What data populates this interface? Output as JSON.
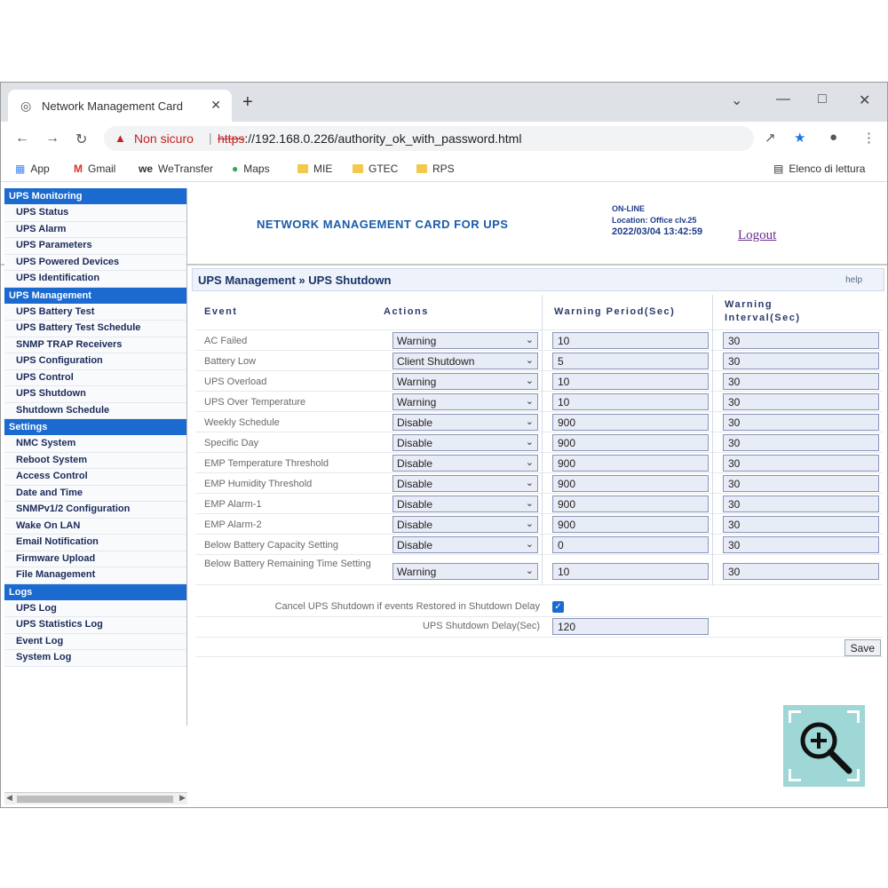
{
  "browser": {
    "tab_title": "Network Management Card",
    "address_warning": "Non sicuro",
    "url_scheme": "https",
    "url_rest": "://192.168.0.226/authority_ok_with_password.html",
    "bookmarks": [
      {
        "label": "App",
        "icon": "grid-icon"
      },
      {
        "label": "Gmail",
        "icon": "gmail-icon"
      },
      {
        "label": "WeTransfer",
        "icon": "wetransfer-icon"
      },
      {
        "label": "Maps",
        "icon": "maps-icon"
      },
      {
        "label": "MIE",
        "icon": "folder-icon"
      },
      {
        "label": "GTEC",
        "icon": "folder-icon"
      },
      {
        "label": "RPS",
        "icon": "folder-icon"
      }
    ],
    "reading_list": "Elenco di lettura"
  },
  "header": {
    "title": "NETWORK MANAGEMENT CARD FOR UPS",
    "status": "ON-LINE",
    "location": "Location: Office clv.25",
    "datetime": "2022/03/04 13:42:59",
    "logout": "Logout"
  },
  "sidebar": [
    {
      "heading": "UPS Monitoring",
      "items": [
        "UPS Status",
        "UPS Alarm",
        "UPS Parameters",
        "UPS Powered Devices",
        "UPS Identification"
      ]
    },
    {
      "heading": "UPS Management",
      "items": [
        "UPS Battery Test",
        "UPS Battery Test Schedule",
        "SNMP TRAP Receivers",
        "UPS Configuration",
        "UPS Control",
        "UPS Shutdown",
        "Shutdown Schedule"
      ]
    },
    {
      "heading": "Settings",
      "items": [
        "NMC System",
        "Reboot System",
        "Access Control",
        "Date and Time",
        "SNMPv1/2 Configuration",
        "Wake On LAN",
        "Email Notification",
        "Firmware Upload",
        "File Management"
      ]
    },
    {
      "heading": "Logs",
      "items": [
        "UPS Log",
        "UPS Statistics Log",
        "Event Log",
        "System Log"
      ]
    }
  ],
  "content": {
    "title": "UPS Management » UPS Shutdown",
    "help": "help",
    "columns": {
      "event": "Event",
      "actions": "Actions",
      "warning_period": "Warning Period(Sec)",
      "warning_interval_1": "Warning",
      "warning_interval_2": "Interval(Sec)"
    },
    "rows": [
      {
        "event": "AC Failed",
        "action": "Warning",
        "period": "10",
        "interval": "30"
      },
      {
        "event": "Battery Low",
        "action": "Client Shutdown",
        "period": "5",
        "interval": "30"
      },
      {
        "event": "UPS Overload",
        "action": "Warning",
        "period": "10",
        "interval": "30"
      },
      {
        "event": "UPS Over Temperature",
        "action": "Warning",
        "period": "10",
        "interval": "30"
      },
      {
        "event": "Weekly Schedule",
        "action": "Disable",
        "period": "900",
        "interval": "30"
      },
      {
        "event": "Specific Day",
        "action": "Disable",
        "period": "900",
        "interval": "30"
      },
      {
        "event": "EMP Temperature Threshold",
        "action": "Disable",
        "period": "900",
        "interval": "30"
      },
      {
        "event": "EMP Humidity Threshold",
        "action": "Disable",
        "period": "900",
        "interval": "30"
      },
      {
        "event": "EMP Alarm-1",
        "action": "Disable",
        "period": "900",
        "interval": "30"
      },
      {
        "event": "EMP Alarm-2",
        "action": "Disable",
        "period": "900",
        "interval": "30"
      },
      {
        "event": "Below Battery Capacity Setting",
        "action": "Disable",
        "period": "0",
        "interval": "30"
      },
      {
        "event": "Below Battery Remaining Time Setting",
        "action": "Warning",
        "period": "10",
        "interval": "30"
      }
    ],
    "cancel_label": "Cancel UPS Shutdown if events Restored in Shutdown Delay",
    "cancel_checked": true,
    "delay_label": "UPS Shutdown Delay(Sec)",
    "delay_value": "120",
    "save": "Save"
  }
}
